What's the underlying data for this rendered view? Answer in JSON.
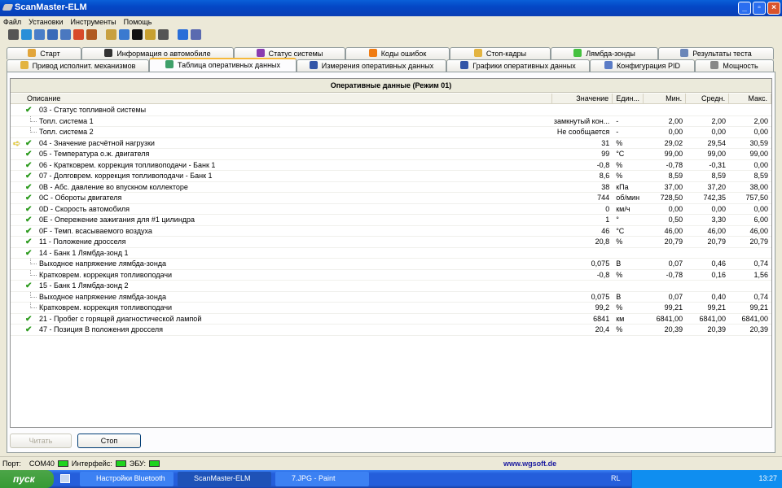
{
  "window": {
    "title": "ScanMaster-ELM"
  },
  "menu": [
    "Файл",
    "Установки",
    "Инструменты",
    "Помощь"
  ],
  "toolbar_icons": [
    "connect-icon",
    "globe-icon",
    "document-icon",
    "table-icon",
    "chart-icon",
    "puzzle-icon",
    "person-icon",
    "clipboard-icon",
    "chat-icon",
    "terminal-icon",
    "battery-icon",
    "gauge-icon",
    "info-icon",
    "exit-icon"
  ],
  "tabs_row1": [
    {
      "label": "Старт",
      "icon": "home-icon",
      "color": "#e2a53a"
    },
    {
      "label": "Информация о автомобиле",
      "icon": "info-icon",
      "color": "#333"
    },
    {
      "label": "Статус системы",
      "icon": "status-icon",
      "color": "#8a3cb0"
    },
    {
      "label": "Коды ошибок",
      "icon": "warning-icon",
      "color": "#f07c12"
    },
    {
      "label": "Стоп-кадры",
      "icon": "snapshot-icon",
      "color": "#e3b441"
    },
    {
      "label": "Лямбда-зонды",
      "icon": "lambda-icon",
      "color": "#45c13f"
    },
    {
      "label": "Результаты теста",
      "icon": "gear-icon",
      "color": "#6b86b8"
    }
  ],
  "tabs_row2": [
    {
      "label": "Привод исполнит. механизмов",
      "icon": "actuator-icon",
      "color": "#e3b441"
    },
    {
      "label": "Таблица оперативных данных",
      "icon": "table-icon",
      "color": "#3fa06a",
      "active": true
    },
    {
      "label": "Измерения оперативных данных",
      "icon": "measure-icon",
      "color": "#3456a8"
    },
    {
      "label": "Графики оперативных данных",
      "icon": "chart-icon",
      "color": "#3456a8"
    },
    {
      "label": "Конфигурация PID",
      "icon": "config-icon",
      "color": "#5b7cc6"
    },
    {
      "label": "Мощность",
      "icon": "power-icon",
      "color": "#888"
    }
  ],
  "grid": {
    "title": "Оперативные данные (Режим 01)",
    "columns": [
      "Описание",
      "Значение",
      "Един...",
      "Мин.",
      "Средн.",
      "Макс."
    ],
    "rows": [
      {
        "d": "03 - Статус топливной системы",
        "check": true,
        "v": "",
        "u": "",
        "min": "",
        "avg": "",
        "max": ""
      },
      {
        "d": "Топл. система 1",
        "sub": true,
        "v": "замкнутый кон...",
        "u": "-",
        "min": "2,00",
        "avg": "2,00",
        "max": "2,00"
      },
      {
        "d": "Топл. система 2",
        "sub": true,
        "v": "Не сообщается",
        "u": "-",
        "min": "0,00",
        "avg": "0,00",
        "max": "0,00"
      },
      {
        "d": "04 - Значение расчётной нагрузки",
        "check": true,
        "arrow": true,
        "v": "31",
        "u": "%",
        "min": "29,02",
        "avg": "29,54",
        "max": "30,59"
      },
      {
        "d": "05 - Температура о.ж. двигателя",
        "check": true,
        "v": "99",
        "u": "°C",
        "min": "99,00",
        "avg": "99,00",
        "max": "99,00"
      },
      {
        "d": "06 - Кратковрем. коррекция топливоподачи - Банк 1",
        "check": true,
        "v": "-0,8",
        "u": "%",
        "min": "-0,78",
        "avg": "-0,31",
        "max": "0,00"
      },
      {
        "d": "07 - Долговрем. коррекция топливоподачи - Банк 1",
        "check": true,
        "v": "8,6",
        "u": "%",
        "min": "8,59",
        "avg": "8,59",
        "max": "8,59"
      },
      {
        "d": "0B - Абс. давление во впускном коллекторе",
        "check": true,
        "v": "38",
        "u": "кПа",
        "min": "37,00",
        "avg": "37,20",
        "max": "38,00"
      },
      {
        "d": "0C - Обороты двигателя",
        "check": true,
        "v": "744",
        "u": "об/мин",
        "min": "728,50",
        "avg": "742,35",
        "max": "757,50"
      },
      {
        "d": "0D - Скорость автомобиля",
        "check": true,
        "v": "0",
        "u": "км/ч",
        "min": "0,00",
        "avg": "0,00",
        "max": "0,00"
      },
      {
        "d": "0E - Опережение зажигания для #1 цилиндра",
        "check": true,
        "v": "1",
        "u": "°",
        "min": "0,50",
        "avg": "3,30",
        "max": "6,00"
      },
      {
        "d": "0F - Темп. всасываемого воздуха",
        "check": true,
        "v": "46",
        "u": "°C",
        "min": "46,00",
        "avg": "46,00",
        "max": "46,00"
      },
      {
        "d": "11 - Положение дросселя",
        "check": true,
        "v": "20,8",
        "u": "%",
        "min": "20,79",
        "avg": "20,79",
        "max": "20,79"
      },
      {
        "d": "14 - Банк 1 Лямбда-зонд 1",
        "check": true,
        "v": "",
        "u": "",
        "min": "",
        "avg": "",
        "max": ""
      },
      {
        "d": "Выходное напряжение лямбда-зонда",
        "sub": true,
        "v": "0,075",
        "u": "В",
        "min": "0,07",
        "avg": "0,46",
        "max": "0,74"
      },
      {
        "d": "Кратковрем. коррекция топливоподачи",
        "sub": true,
        "v": "-0,8",
        "u": "%",
        "min": "-0,78",
        "avg": "0,16",
        "max": "1,56"
      },
      {
        "d": "15 - Банк 1 Лямбда-зонд 2",
        "check": true,
        "v": "",
        "u": "",
        "min": "",
        "avg": "",
        "max": ""
      },
      {
        "d": "Выходное напряжение лямбда-зонда",
        "sub": true,
        "v": "0,075",
        "u": "В",
        "min": "0,07",
        "avg": "0,40",
        "max": "0,74"
      },
      {
        "d": "Кратковрем. коррекция топливоподачи",
        "sub": true,
        "v": "99,2",
        "u": "%",
        "min": "99,21",
        "avg": "99,21",
        "max": "99,21"
      },
      {
        "d": "21 - Пробег с горящей диагностической лампой",
        "check": true,
        "v": "6841",
        "u": "км",
        "min": "6841,00",
        "avg": "6841,00",
        "max": "6841,00"
      },
      {
        "d": "47 - Позиция В положения дросселя",
        "check": true,
        "v": "20,4",
        "u": "%",
        "min": "20,39",
        "avg": "20,39",
        "max": "20,39"
      }
    ]
  },
  "buttons": {
    "read": "Читать",
    "stop": "Стоп"
  },
  "status": {
    "port_label": "Порт:",
    "port": "COM40",
    "interface_label": "Интерфейс:",
    "ecu_label": "ЭБУ:",
    "url": "www.wgsoft.de"
  },
  "taskbar": {
    "start": "пуск",
    "tasks": [
      "Настройки Bluetooth",
      "ScanMaster-ELM",
      "7.JPG - Paint"
    ],
    "lang": "RL",
    "clock": "13:27"
  }
}
